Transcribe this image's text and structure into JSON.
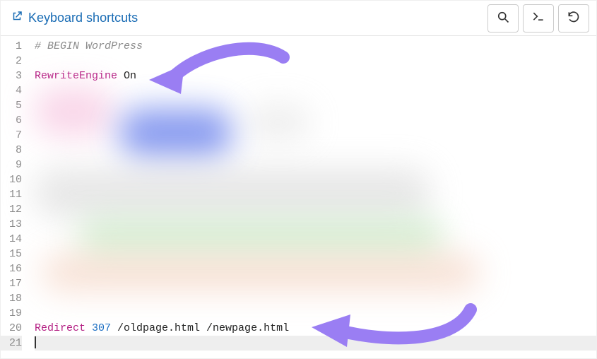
{
  "header": {
    "keyboard_shortcuts_label": "Keyboard shortcuts"
  },
  "buttons": {
    "search": "search",
    "command": "command",
    "undo": "undo"
  },
  "editor": {
    "active_line": 21,
    "lines": [
      {
        "n": 1,
        "comment": "# BEGIN WordPress"
      },
      {
        "n": 2,
        "empty": true
      },
      {
        "n": 3,
        "directive": "RewriteEngine",
        "args": " On"
      },
      {
        "n": 4,
        "empty": true
      },
      {
        "n": 5,
        "blurred": true
      },
      {
        "n": 6,
        "blurred": true
      },
      {
        "n": 7,
        "blurred": true
      },
      {
        "n": 8,
        "blurred": true
      },
      {
        "n": 9,
        "blurred": true
      },
      {
        "n": 10,
        "blurred": true
      },
      {
        "n": 11,
        "blurred": true
      },
      {
        "n": 12,
        "blurred": true
      },
      {
        "n": 13,
        "blurred": true
      },
      {
        "n": 14,
        "blurred": true
      },
      {
        "n": 15,
        "blurred": true
      },
      {
        "n": 16,
        "blurred": true
      },
      {
        "n": 17,
        "blurred": true
      },
      {
        "n": 18,
        "blurred": true
      },
      {
        "n": 19,
        "empty": true
      },
      {
        "n": 20,
        "directive": "Redirect",
        "num": " 307",
        "args": " /oldpage.html /newpage.html"
      },
      {
        "n": 21,
        "cursor": true
      }
    ]
  }
}
